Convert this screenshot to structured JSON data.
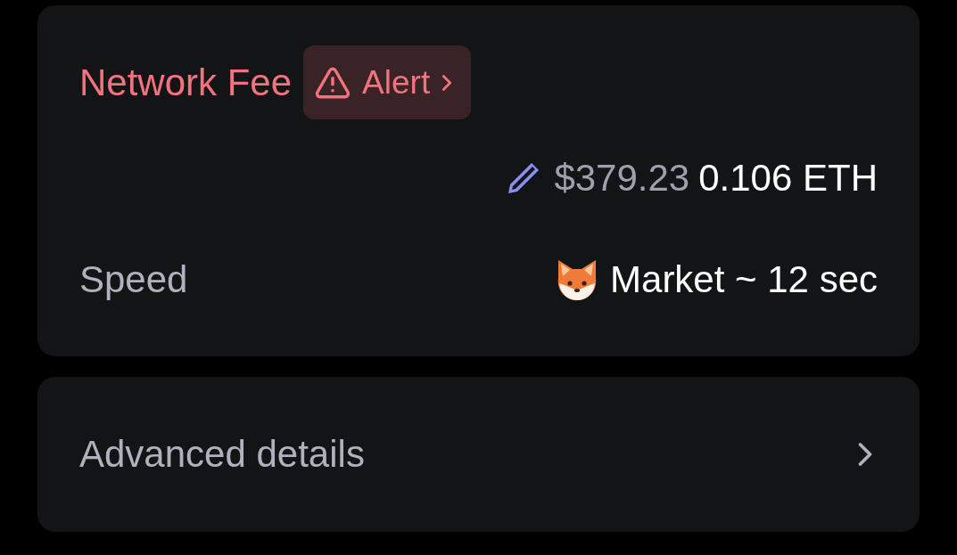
{
  "network_fee": {
    "label": "Network Fee",
    "alert": {
      "label": "Alert"
    },
    "fiat": "$379.23",
    "amount": "0.106 ETH"
  },
  "speed": {
    "label": "Speed",
    "value": "Market ~ 12 sec"
  },
  "advanced_details": {
    "label": "Advanced details"
  }
}
